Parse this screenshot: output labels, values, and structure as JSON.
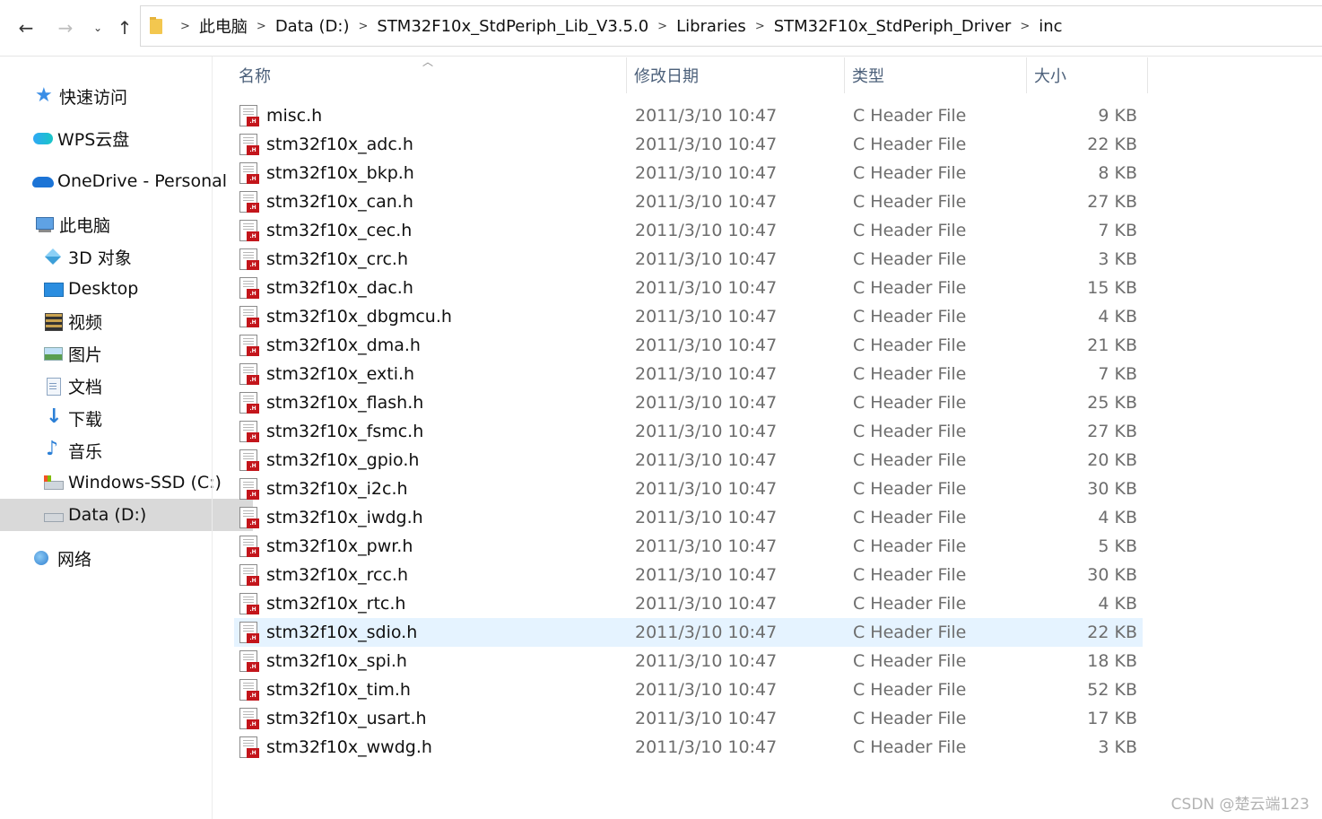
{
  "nav": {
    "back_icon": "back-arrow-icon",
    "forward_icon": "forward-arrow-icon",
    "recent_icon": "chevron-down-icon",
    "up_icon": "up-arrow-icon"
  },
  "address_bar": {
    "crumbs": [
      "此电脑",
      "Data (D:)",
      "STM32F10x_StdPeriph_Lib_V3.5.0",
      "Libraries",
      "STM32F10x_StdPeriph_Driver",
      "inc"
    ]
  },
  "sidebar": {
    "items": [
      {
        "label": "快速访问",
        "icon": "star-icon"
      },
      {
        "label": "WPS云盘",
        "icon": "cloud-icon"
      },
      {
        "label": "OneDrive - Personal",
        "icon": "onedrive-icon"
      },
      {
        "label": "此电脑",
        "icon": "computer-icon"
      },
      {
        "label": "3D 对象",
        "icon": "cube-icon"
      },
      {
        "label": "Desktop",
        "icon": "desktop-icon"
      },
      {
        "label": "视频",
        "icon": "video-icon"
      },
      {
        "label": "图片",
        "icon": "picture-icon"
      },
      {
        "label": "文档",
        "icon": "document-icon"
      },
      {
        "label": "下载",
        "icon": "download-icon"
      },
      {
        "label": "音乐",
        "icon": "music-icon"
      },
      {
        "label": "Windows-SSD (C:)",
        "icon": "drive-icon"
      },
      {
        "label": "Data (D:)",
        "icon": "drive-icon",
        "selected": true
      },
      {
        "label": "网络",
        "icon": "network-icon"
      }
    ]
  },
  "columns": {
    "name": "名称",
    "modified": "修改日期",
    "type": "类型",
    "size": "大小"
  },
  "files": [
    {
      "name": "misc.h",
      "modified": "2011/3/10 10:47",
      "type": "C Header File",
      "size": "9 KB"
    },
    {
      "name": "stm32f10x_adc.h",
      "modified": "2011/3/10 10:47",
      "type": "C Header File",
      "size": "22 KB"
    },
    {
      "name": "stm32f10x_bkp.h",
      "modified": "2011/3/10 10:47",
      "type": "C Header File",
      "size": "8 KB"
    },
    {
      "name": "stm32f10x_can.h",
      "modified": "2011/3/10 10:47",
      "type": "C Header File",
      "size": "27 KB"
    },
    {
      "name": "stm32f10x_cec.h",
      "modified": "2011/3/10 10:47",
      "type": "C Header File",
      "size": "7 KB"
    },
    {
      "name": "stm32f10x_crc.h",
      "modified": "2011/3/10 10:47",
      "type": "C Header File",
      "size": "3 KB"
    },
    {
      "name": "stm32f10x_dac.h",
      "modified": "2011/3/10 10:47",
      "type": "C Header File",
      "size": "15 KB"
    },
    {
      "name": "stm32f10x_dbgmcu.h",
      "modified": "2011/3/10 10:47",
      "type": "C Header File",
      "size": "4 KB"
    },
    {
      "name": "stm32f10x_dma.h",
      "modified": "2011/3/10 10:47",
      "type": "C Header File",
      "size": "21 KB"
    },
    {
      "name": "stm32f10x_exti.h",
      "modified": "2011/3/10 10:47",
      "type": "C Header File",
      "size": "7 KB"
    },
    {
      "name": "stm32f10x_flash.h",
      "modified": "2011/3/10 10:47",
      "type": "C Header File",
      "size": "25 KB"
    },
    {
      "name": "stm32f10x_fsmc.h",
      "modified": "2011/3/10 10:47",
      "type": "C Header File",
      "size": "27 KB"
    },
    {
      "name": "stm32f10x_gpio.h",
      "modified": "2011/3/10 10:47",
      "type": "C Header File",
      "size": "20 KB"
    },
    {
      "name": "stm32f10x_i2c.h",
      "modified": "2011/3/10 10:47",
      "type": "C Header File",
      "size": "30 KB"
    },
    {
      "name": "stm32f10x_iwdg.h",
      "modified": "2011/3/10 10:47",
      "type": "C Header File",
      "size": "4 KB"
    },
    {
      "name": "stm32f10x_pwr.h",
      "modified": "2011/3/10 10:47",
      "type": "C Header File",
      "size": "5 KB"
    },
    {
      "name": "stm32f10x_rcc.h",
      "modified": "2011/3/10 10:47",
      "type": "C Header File",
      "size": "30 KB"
    },
    {
      "name": "stm32f10x_rtc.h",
      "modified": "2011/3/10 10:47",
      "type": "C Header File",
      "size": "4 KB"
    },
    {
      "name": "stm32f10x_sdio.h",
      "modified": "2011/3/10 10:47",
      "type": "C Header File",
      "size": "22 KB",
      "selected": true
    },
    {
      "name": "stm32f10x_spi.h",
      "modified": "2011/3/10 10:47",
      "type": "C Header File",
      "size": "18 KB"
    },
    {
      "name": "stm32f10x_tim.h",
      "modified": "2011/3/10 10:47",
      "type": "C Header File",
      "size": "52 KB"
    },
    {
      "name": "stm32f10x_usart.h",
      "modified": "2011/3/10 10:47",
      "type": "C Header File",
      "size": "17 KB"
    },
    {
      "name": "stm32f10x_wwdg.h",
      "modified": "2011/3/10 10:47",
      "type": "C Header File",
      "size": "3 KB"
    }
  ],
  "file_icon_badge": ".H",
  "watermark": "CSDN @楚云端123",
  "colors": {
    "selected_row": "#e5f3ff",
    "selected_sidebar": "#d9d9d9",
    "header_text": "#4c607a",
    "file_badge": "#c3151b"
  }
}
